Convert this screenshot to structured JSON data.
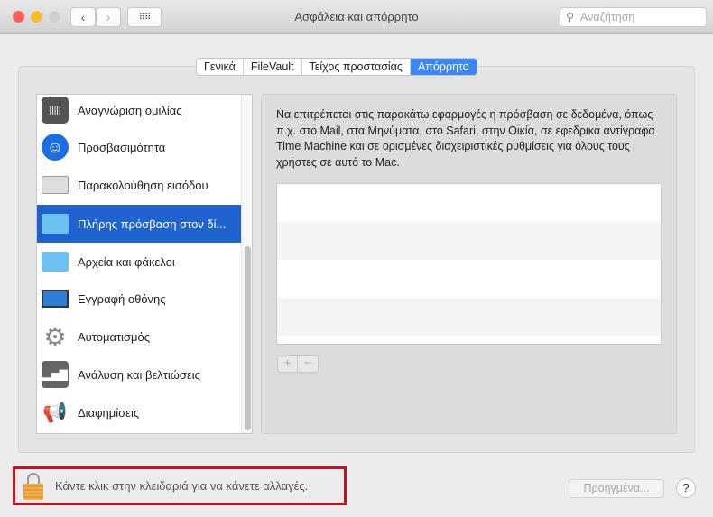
{
  "window": {
    "title": "Ασφάλεια και απόρρητο",
    "search_placeholder": "Αναζήτηση"
  },
  "tabs": [
    {
      "label": "Γενικά"
    },
    {
      "label": "FileVault"
    },
    {
      "label": "Τείχος προστασίας"
    },
    {
      "label": "Απόρρητο",
      "active": true
    }
  ],
  "sidebar": {
    "items": [
      {
        "label": "Αναγνώριση ομιλίας",
        "icon": "waveform-icon"
      },
      {
        "label": "Προσβασιμότητα",
        "icon": "accessibility-icon"
      },
      {
        "label": "Παρακολούθηση εισόδου",
        "icon": "keyboard-icon"
      },
      {
        "label": "Πλήρης πρόσβαση στον δί...",
        "icon": "folder-icon",
        "selected": true
      },
      {
        "label": "Αρχεία και φάκελοι",
        "icon": "folder-icon"
      },
      {
        "label": "Εγγραφή οθόνης",
        "icon": "display-icon"
      },
      {
        "label": "Αυτοματισμός",
        "icon": "gear-icon"
      },
      {
        "label": "Ανάλυση και βελτιώσεις",
        "icon": "chart-icon"
      },
      {
        "label": "Διαφημίσεις",
        "icon": "megaphone-icon"
      }
    ]
  },
  "detail": {
    "description": "Να επιτρέπεται στις παρακάτω εφαρμογές η πρόσβαση σε δεδομένα, όπως π.χ. στο Mail, στα Μηνύματα, στο Safari, στην Οικία, σε εφεδρικά αντίγραφα Time Machine και σε ορισμένες διαχειριστικές ρυθμίσεις για όλους τους χρήστες σε αυτό το Mac.",
    "add": "+",
    "remove": "−"
  },
  "footer": {
    "lock_text": "Κάντε κλικ στην κλειδαριά για να κάνετε αλλαγές.",
    "advanced": "Προηγμένα...",
    "help": "?"
  }
}
